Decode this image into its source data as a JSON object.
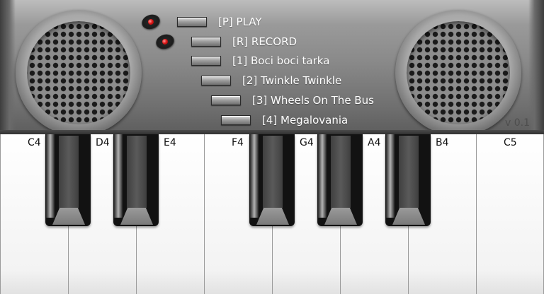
{
  "menu": {
    "play": "[P] PLAY",
    "record": "[R] RECORD",
    "song1": "[1] Boci boci tarka",
    "song2": "[2] Twinkle Twinkle",
    "song3": "[3] Wheels On The Bus",
    "song4": "[4] Megalovania"
  },
  "version": "v 0.1",
  "keys": {
    "C4": "C4",
    "D4": "D4",
    "E4": "E4",
    "F4": "F4",
    "G4": "G4",
    "A4": "A4",
    "B4": "B4",
    "C5": "C5"
  },
  "colors": {
    "indicator": "#e01a1a",
    "panel": "#8a8a8a",
    "black_key": "#121212",
    "white_key": "#f7f7f7"
  }
}
